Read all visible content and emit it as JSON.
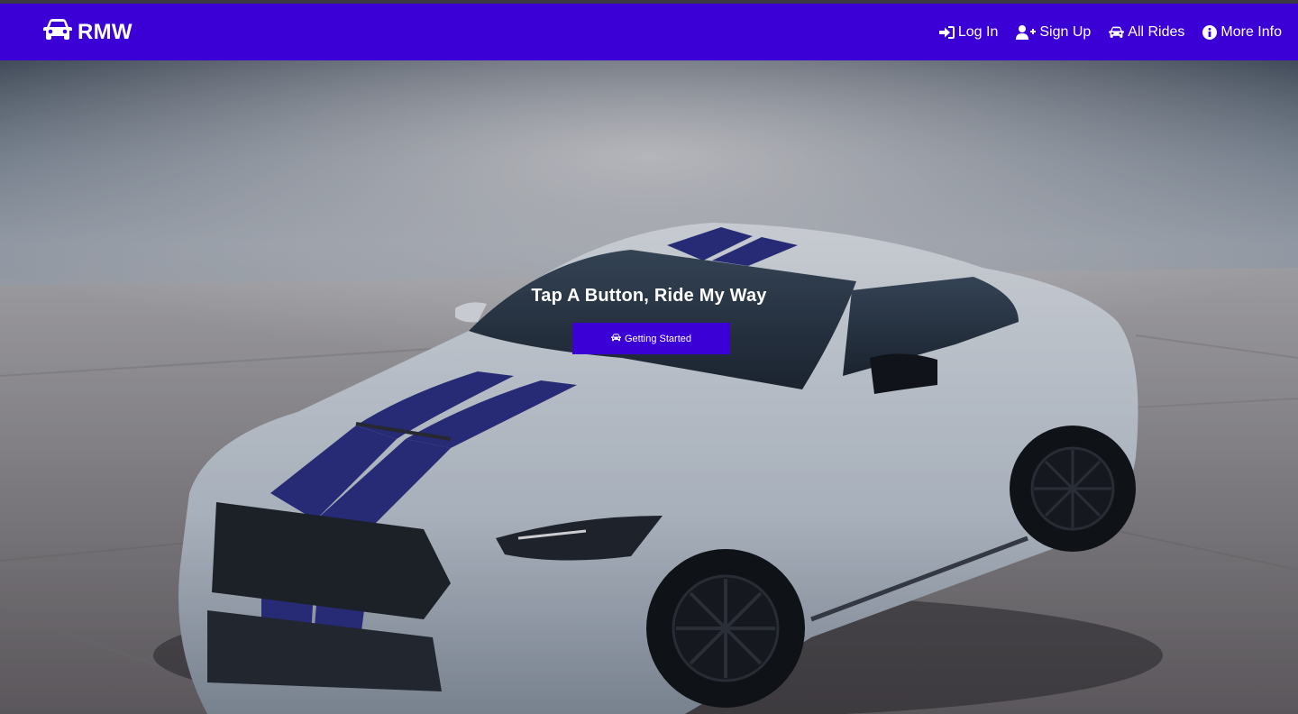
{
  "brand": {
    "name": "RMW",
    "icon": "car-icon"
  },
  "nav": {
    "items": [
      {
        "label": "Log In",
        "icon": "sign-in-icon"
      },
      {
        "label": "Sign Up",
        "icon": "user-plus-icon"
      },
      {
        "label": "All Rides",
        "icon": "car-icon"
      },
      {
        "label": "More Info",
        "icon": "info-circle-icon"
      }
    ]
  },
  "hero": {
    "title": "Tap A Button, Ride My Way",
    "button_label": "Getting Started",
    "button_icon": "car-icon",
    "background": "white sports car with blue racing stripes on misty concrete"
  },
  "colors": {
    "primary": "#3a00d6",
    "text": "#ffffff"
  }
}
